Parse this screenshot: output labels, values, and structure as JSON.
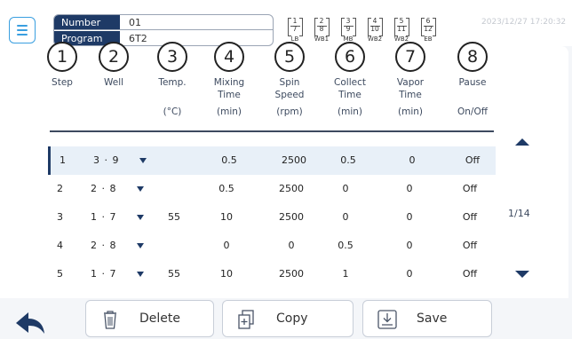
{
  "header": {
    "menu_icon": "hamburger-icon",
    "number_label": "Number",
    "number_value": "01",
    "program_label": "Program",
    "program_value": "6T2",
    "datetime": "2023/12/27 17:20:32",
    "wells": [
      {
        "top": "1",
        "bottom": "7",
        "label": "LB"
      },
      {
        "top": "2",
        "bottom": "8",
        "label": "WB1"
      },
      {
        "top": "3",
        "bottom": "9",
        "label": "MB"
      },
      {
        "top": "4",
        "bottom": "10",
        "label": "WB2"
      },
      {
        "top": "5",
        "bottom": "11",
        "label": "WB2"
      },
      {
        "top": "6",
        "bottom": "12",
        "label": "EB"
      }
    ]
  },
  "columns": [
    {
      "num": "1",
      "title": "Step",
      "unit": ""
    },
    {
      "num": "2",
      "title": "Well",
      "unit": ""
    },
    {
      "num": "3",
      "title": "Temp.",
      "unit": "(°C)"
    },
    {
      "num": "4",
      "title": "Mixing\nTime",
      "unit": "(min)"
    },
    {
      "num": "5",
      "title": "Spin\nSpeed",
      "unit": "(rpm)"
    },
    {
      "num": "6",
      "title": "Collect\nTime",
      "unit": "(min)"
    },
    {
      "num": "7",
      "title": "Vapor\nTime",
      "unit": "(min)"
    },
    {
      "num": "8",
      "title": "Pause",
      "unit": "On/Off"
    }
  ],
  "rows": [
    {
      "step": "1",
      "well": "3 · 9",
      "temp": "",
      "mix": "0.5",
      "spin": "2500",
      "collect": "0.5",
      "vapor": "0",
      "pause": "Off",
      "selected": true
    },
    {
      "step": "2",
      "well": "2 · 8",
      "temp": "",
      "mix": "0.5",
      "spin": "2500",
      "collect": "0",
      "vapor": "0",
      "pause": "Off",
      "selected": false
    },
    {
      "step": "3",
      "well": "1 · 7",
      "temp": "55",
      "mix": "10",
      "spin": "2500",
      "collect": "0",
      "vapor": "0",
      "pause": "Off",
      "selected": false
    },
    {
      "step": "4",
      "well": "2 · 8",
      "temp": "",
      "mix": "0",
      "spin": "0",
      "collect": "0.5",
      "vapor": "0",
      "pause": "Off",
      "selected": false
    },
    {
      "step": "5",
      "well": "1 · 7",
      "temp": "55",
      "mix": "10",
      "spin": "2500",
      "collect": "1",
      "vapor": "0",
      "pause": "Off",
      "selected": false
    }
  ],
  "pagination": {
    "indicator": "1/14"
  },
  "actions": {
    "delete_label": "Delete",
    "copy_label": "Copy",
    "save_label": "Save"
  },
  "colors": {
    "accent": "#3a9fe0",
    "navy": "#1e3a66",
    "selected_row": "#e8f0f8"
  }
}
